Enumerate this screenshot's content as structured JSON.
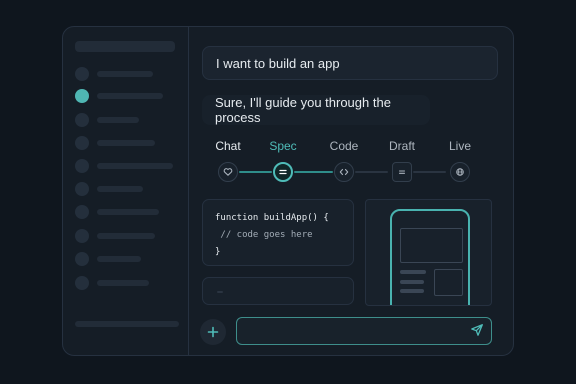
{
  "chat": {
    "user_message": "I want to build an app",
    "assistant_message": "Sure, I'll guide you through the process"
  },
  "steps": [
    {
      "label": "Chat",
      "icon": "heart-icon",
      "state": "done"
    },
    {
      "label": "Spec",
      "icon": "equals-icon",
      "state": "active"
    },
    {
      "label": "Code",
      "icon": "code-icon",
      "state": "pending"
    },
    {
      "label": "Draft",
      "icon": "draft-icon",
      "state": "pending"
    },
    {
      "label": "Live",
      "icon": "globe-icon",
      "state": "pending"
    }
  ],
  "code": {
    "line1": "function buildApp() {",
    "line2": " // code goes here",
    "line3": "}"
  },
  "composer": {
    "placeholder": "",
    "add_icon": "plus-icon",
    "send_icon": "send-icon"
  },
  "colors": {
    "accent": "#4fbcb8",
    "background": "#0f161e",
    "panel": "#151d26"
  }
}
